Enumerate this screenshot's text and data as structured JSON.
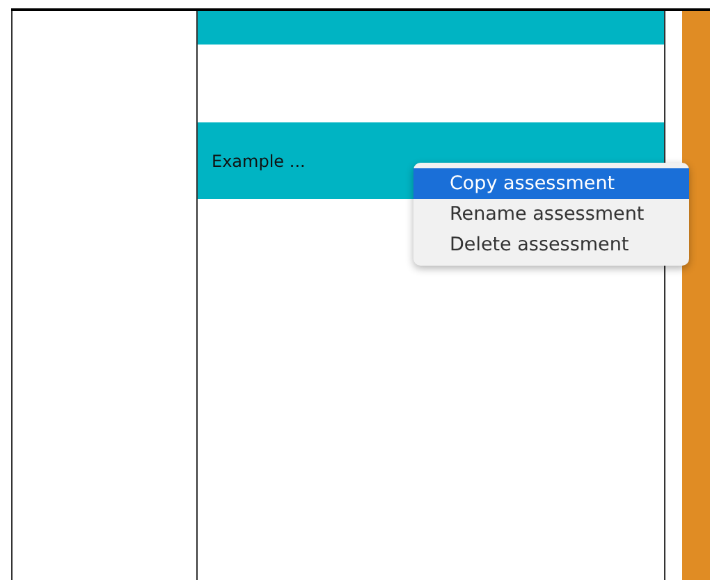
{
  "assessments": [
    {
      "selected": true
    },
    {
      "selected": false
    },
    {
      "label": "Example ...",
      "selected": true
    }
  ],
  "context_menu": {
    "items": [
      {
        "label": "Copy assessment",
        "selected": true
      },
      {
        "label": "Rename assessment",
        "selected": false
      },
      {
        "label": "Delete assessment",
        "selected": false
      }
    ]
  }
}
